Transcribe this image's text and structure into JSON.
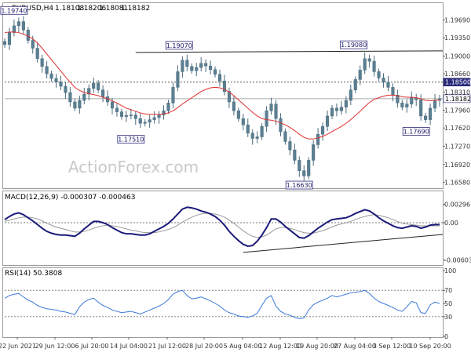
{
  "chart_data": [
    {
      "type": "candlestick",
      "panel": "price",
      "symbol": "EURUSD,H4",
      "ohlc_readout": [
        "1.18108",
        "1.18206",
        "1.18081",
        "1.18182"
      ],
      "y_ticks": [
        1.1969,
        1.1935,
        1.19,
        1.1866,
        1.1831,
        1.1796,
        1.1762,
        1.1727,
        1.1692,
        1.1658
      ],
      "y_tick_labels": [
        "1.19690",
        "1.19350",
        "1.19000",
        "1.18660",
        "1.18310",
        "1.17960",
        "1.17620",
        "1.17270",
        "1.16920",
        "1.16580"
      ],
      "ylim": [
        1.1648,
        1.2
      ],
      "x_ticks": [
        "22 Jun 2021",
        "29 Jun 12:00",
        "6 Jul 20:00",
        "14 Jul 04:00",
        "21 Jul 12:00",
        "28 Jul 20:00",
        "5 Aug 04:00",
        "12 Aug 12:00",
        "19 Aug 20:00",
        "27 Aug 04:00",
        "3 Sep 12:00",
        "10 Sep 20:00"
      ],
      "close": [
        1.1922,
        1.1945,
        1.1958,
        1.1966,
        1.195,
        1.193,
        1.1915,
        1.1895,
        1.188,
        1.1866,
        1.1857,
        1.185,
        1.1842,
        1.183,
        1.1812,
        1.18,
        1.1815,
        1.1827,
        1.1838,
        1.1848,
        1.1835,
        1.1822,
        1.1812,
        1.18,
        1.1793,
        1.1784,
        1.1786,
        1.1787,
        1.178,
        1.1771,
        1.1773,
        1.1778,
        1.1782,
        1.1787,
        1.1795,
        1.181,
        1.184,
        1.187,
        1.1892,
        1.188,
        1.1872,
        1.1878,
        1.1886,
        1.1881,
        1.1874,
        1.1865,
        1.1852,
        1.1832,
        1.1812,
        1.1795,
        1.178,
        1.1768,
        1.1752,
        1.1742,
        1.1745,
        1.1765,
        1.1795,
        1.1808,
        1.178,
        1.1755,
        1.1736,
        1.172,
        1.17,
        1.168,
        1.167,
        1.17,
        1.173,
        1.175,
        1.1765,
        1.1785,
        1.18,
        1.1795,
        1.1802,
        1.1815,
        1.1835,
        1.1855,
        1.1873,
        1.1895,
        1.189,
        1.187,
        1.1858,
        1.185,
        1.184,
        1.1825,
        1.181,
        1.1802,
        1.1808,
        1.182,
        1.1816,
        1.1785,
        1.1778,
        1.18,
        1.1815,
        1.1818
      ],
      "ema_line": [
        1.1945,
        1.1946,
        1.1946,
        1.1945,
        1.1942,
        1.1938,
        1.1933,
        1.1925,
        1.1915,
        1.1904,
        1.1893,
        1.1882,
        1.1871,
        1.186,
        1.185,
        1.184,
        1.1834,
        1.183,
        1.1828,
        1.1826,
        1.1824,
        1.1821,
        1.1818,
        1.1814,
        1.181,
        1.1805,
        1.18,
        1.1797,
        1.1794,
        1.1791,
        1.1789,
        1.1788,
        1.1788,
        1.1788,
        1.1789,
        1.1791,
        1.1795,
        1.1801,
        1.1808,
        1.1814,
        1.182,
        1.1826,
        1.1832,
        1.1836,
        1.1839,
        1.184,
        1.1839,
        1.1836,
        1.1831,
        1.1824,
        1.1816,
        1.1808,
        1.18,
        1.1792,
        1.1785,
        1.178,
        1.1778,
        1.1777,
        1.1775,
        1.1772,
        1.1768,
        1.1763,
        1.1757,
        1.175,
        1.1744,
        1.1741,
        1.1741,
        1.1743,
        1.1746,
        1.175,
        1.1755,
        1.176,
        1.1765,
        1.1771,
        1.1778,
        1.1786,
        1.1794,
        1.1803,
        1.1811,
        1.1817,
        1.182,
        1.1823,
        1.1825,
        1.1825,
        1.1824,
        1.1822,
        1.1821,
        1.1821,
        1.182,
        1.1818,
        1.1815,
        1.1814,
        1.1815,
        1.1816
      ],
      "horizontal_lines": [
        {
          "label": "1.18500",
          "value": 1.185,
          "style": "dotted"
        },
        {
          "label": "1.18182",
          "value": 1.18182,
          "style": "solid-gray"
        }
      ],
      "trendline": {
        "from": 1.1907,
        "to": 1.191
      },
      "annotations": [
        {
          "text": "1.19740",
          "value": 1.1974
        },
        {
          "text": "1.19070",
          "value": 1.1907
        },
        {
          "text": "1.17510",
          "value": 1.1751
        },
        {
          "text": "1.16630",
          "value": 1.1663
        },
        {
          "text": "1.19080",
          "value": 1.1908
        },
        {
          "text": "1.17690",
          "value": 1.1769
        }
      ],
      "watermark": "ActionForex.com"
    },
    {
      "type": "line",
      "panel": "macd",
      "title": "MACD(12,26,9) -0.000307 -0.000463",
      "y_ticks": [
        0.002961,
        0.0,
        -0.006039
      ],
      "y_tick_labels": [
        "0.002961",
        "0.00",
        "-0.006039"
      ],
      "ylim": [
        -0.0066,
        0.0033
      ],
      "macd": [
        0.0005,
        0.001,
        0.0014,
        0.0016,
        0.0013,
        0.0008,
        0.0003,
        -0.0003,
        -0.0009,
        -0.0014,
        -0.0017,
        -0.0019,
        -0.002,
        -0.002,
        -0.0021,
        -0.0022,
        -0.0017,
        -0.001,
        -0.0004,
        0.0002,
        0.0002,
        0.0,
        -0.0003,
        -0.0008,
        -0.0012,
        -0.0016,
        -0.0018,
        -0.0018,
        -0.0019,
        -0.002,
        -0.002,
        -0.0018,
        -0.0014,
        -0.001,
        -0.0006,
        -0.0001,
        0.0006,
        0.0014,
        0.0022,
        0.0025,
        0.0024,
        0.0022,
        0.0019,
        0.0017,
        0.0014,
        0.001,
        0.0004,
        -0.0004,
        -0.0014,
        -0.0022,
        -0.0029,
        -0.0035,
        -0.0038,
        -0.0037,
        -0.003,
        -0.002,
        -0.0008,
        0.0006,
        0.0006,
        0.0001,
        -0.0006,
        -0.0012,
        -0.0018,
        -0.0024,
        -0.0025,
        -0.0021,
        -0.0015,
        -0.0009,
        -0.0004,
        0.0001,
        0.0005,
        0.0006,
        0.0007,
        0.0008,
        0.0011,
        0.0015,
        0.0018,
        0.0021,
        0.0019,
        0.0014,
        0.0008,
        0.0003,
        -0.0001,
        -0.0005,
        -0.0008,
        -0.0009,
        -0.0007,
        -0.0005,
        -0.0006,
        -0.0009,
        -0.0007,
        -0.0004,
        -0.0003,
        -0.0003
      ],
      "signal": [
        0.0002,
        0.0004,
        0.0006,
        0.0008,
        0.0009,
        0.0009,
        0.0008,
        0.0006,
        0.0003,
        -0.0001,
        -0.0004,
        -0.0007,
        -0.0009,
        -0.0011,
        -0.0013,
        -0.0015,
        -0.0015,
        -0.0014,
        -0.0012,
        -0.0009,
        -0.0007,
        -0.0005,
        -0.0004,
        -0.0005,
        -0.0006,
        -0.0008,
        -0.001,
        -0.0012,
        -0.0013,
        -0.0015,
        -0.0016,
        -0.0016,
        -0.0016,
        -0.0015,
        -0.0013,
        -0.0011,
        -0.0008,
        -0.0004,
        0.0001,
        0.0005,
        0.0009,
        0.0012,
        0.0014,
        0.0015,
        0.0015,
        0.0014,
        0.0012,
        0.0009,
        0.0004,
        -0.0001,
        -0.0007,
        -0.0013,
        -0.0018,
        -0.0022,
        -0.0024,
        -0.0023,
        -0.002,
        -0.0015,
        -0.001,
        -0.0008,
        -0.0008,
        -0.0009,
        -0.0011,
        -0.0014,
        -0.0016,
        -0.0017,
        -0.0017,
        -0.0015,
        -0.0013,
        -0.001,
        -0.0007,
        -0.0004,
        -0.0002,
        0.0,
        0.0002,
        0.0005,
        0.0008,
        0.001,
        0.0012,
        0.0013,
        0.0012,
        0.001,
        0.0008,
        0.0005,
        0.0002,
        -0.0001,
        -0.0002,
        -0.0003,
        -0.0004,
        -0.0005,
        -0.0005,
        -0.0005,
        -0.0005,
        -0.0005
      ],
      "trendline": {
        "from": -0.0048,
        "to": -0.0019
      }
    },
    {
      "type": "line",
      "panel": "rsi",
      "title": "RSI(14) 50.3808",
      "y_ticks": [
        100,
        70,
        50,
        30,
        0
      ],
      "y_tick_labels": [
        "100",
        "70",
        "50",
        "30",
        "0"
      ],
      "ylim": [
        0,
        100
      ],
      "rsi": [
        58,
        62,
        64,
        65,
        60,
        55,
        52,
        47,
        44,
        42,
        41,
        40,
        38,
        37,
        35,
        33,
        45,
        52,
        56,
        58,
        52,
        47,
        44,
        40,
        38,
        36,
        37,
        38,
        36,
        34,
        37,
        40,
        43,
        46,
        50,
        56,
        64,
        68,
        70,
        62,
        57,
        58,
        60,
        57,
        54,
        50,
        46,
        40,
        36,
        34,
        31,
        30,
        29,
        31,
        35,
        47,
        58,
        62,
        46,
        38,
        34,
        32,
        29,
        27,
        28,
        40,
        48,
        52,
        55,
        58,
        62,
        60,
        62,
        64,
        66,
        67,
        68,
        70,
        65,
        58,
        53,
        50,
        47,
        44,
        40,
        38,
        45,
        53,
        51,
        36,
        35,
        48,
        52,
        50
      ]
    }
  ]
}
